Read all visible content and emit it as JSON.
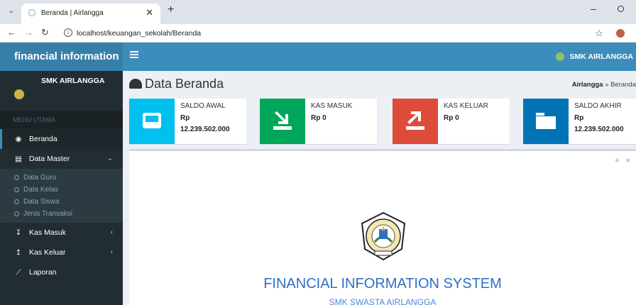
{
  "browser": {
    "tab_title": "Beranda | Airlangga",
    "url": "localhost/keuangan_sekolah/Beranda"
  },
  "header": {
    "brand": "financial information",
    "user": "SMK AIRLANGGA"
  },
  "sidebar": {
    "school": "SMK AIRLANGGA",
    "menu_header": "MENU UTAMA",
    "items": [
      {
        "label": "Beranda",
        "icon": "dashboard-icon"
      },
      {
        "label": "Data Master",
        "icon": "database-icon"
      },
      {
        "label": "Kas Masuk",
        "icon": "arrow-down-icon"
      },
      {
        "label": "Kas Keluar",
        "icon": "arrow-up-icon"
      },
      {
        "label": "Laporan",
        "icon": "line-chart-icon"
      }
    ],
    "submenu": [
      "Data Guru",
      "Data Kelas",
      "Data Siswa",
      "Jenis Transaksi"
    ]
  },
  "content": {
    "title": "Data Beranda",
    "breadcrumb_home": "Airlangga",
    "breadcrumb_sep": "»",
    "breadcrumb_current": "Beranda"
  },
  "info_boxes": [
    {
      "label": "SALDO AWAL",
      "line1": "Rp",
      "line2": "12.239.502.000",
      "color": "#00c0ef",
      "icon": "inbox-icon"
    },
    {
      "label": "KAS MASUK",
      "line1": "Rp 0",
      "line2": "",
      "color": "#00a65a",
      "icon": "download-icon"
    },
    {
      "label": "KAS KELUAR",
      "line1": "Rp 0",
      "line2": "",
      "color": "#dd4b39",
      "icon": "upload-icon"
    },
    {
      "label": "SALDO AKHIR",
      "line1": "Rp",
      "line2": "12.239.502.000",
      "color": "#0073b7",
      "icon": "folder-icon"
    }
  ],
  "main": {
    "heading": "FINANCIAL INFORMATION SYSTEM",
    "subheading": "SMK SWASTA AIRLANGGA",
    "seal_text": "YAYASAN PENDIDIKAN AIRLANGGA",
    "seal_bottom": "LANGSAT"
  }
}
